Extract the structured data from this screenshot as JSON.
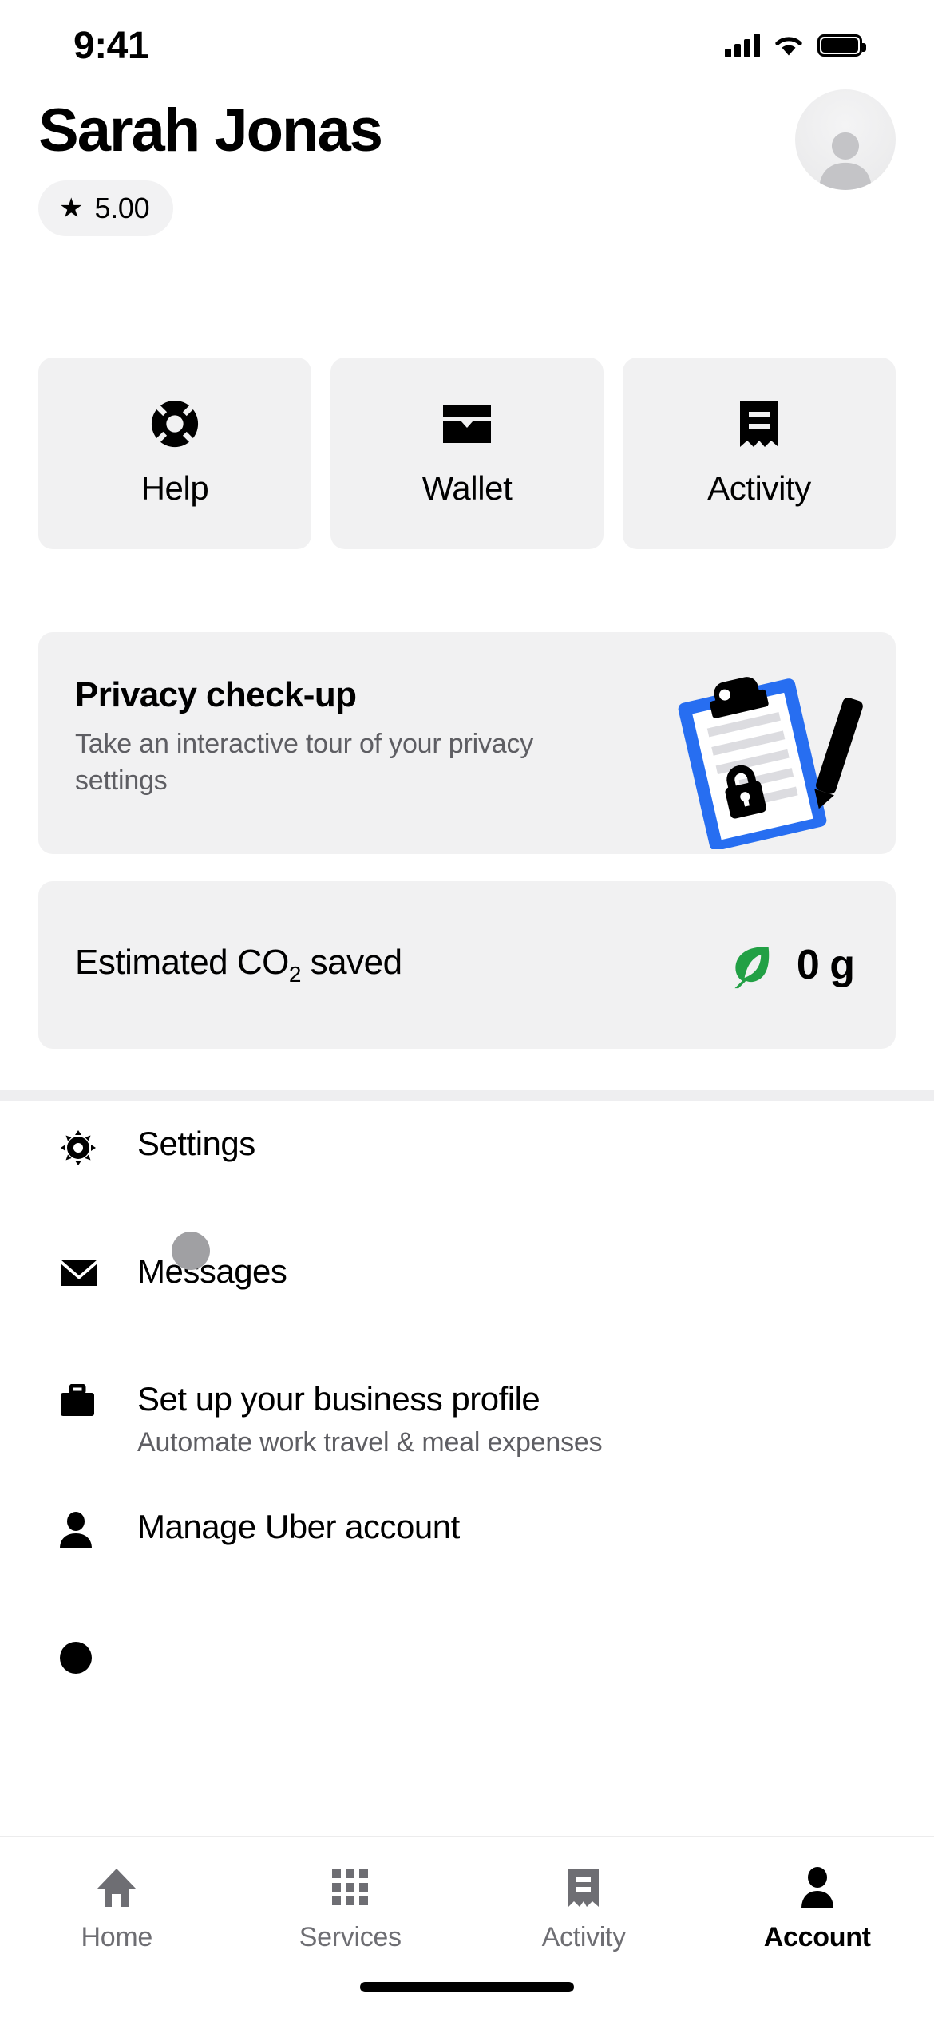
{
  "status_bar": {
    "time": "9:41",
    "cellular_icon": "signal-bars-icon",
    "wifi_icon": "wifi-icon",
    "battery_icon": "battery-full-icon"
  },
  "header": {
    "profile_name": "Sarah Jonas",
    "rating": {
      "star_icon": "star-icon",
      "value": "5.00"
    },
    "avatar_icon": "avatar-person-icon"
  },
  "quick_tiles": [
    {
      "label": "Help",
      "icon": "lifebuoy-icon"
    },
    {
      "label": "Wallet",
      "icon": "wallet-icon"
    },
    {
      "label": "Activity",
      "icon": "receipt-icon"
    }
  ],
  "privacy_card": {
    "title": "Privacy check-up",
    "subtitle": "Take an interactive tour of your privacy settings",
    "illustration_icon": "clipboard-lock-pen-illustration",
    "accent_color": "#276EF1"
  },
  "co2_card": {
    "label_prefix": "Estimated CO",
    "label_sub": "2",
    "label_suffix": " saved",
    "leaf_icon": "leaf-icon",
    "leaf_color": "#22A045",
    "value": "0 g"
  },
  "menu_items": [
    {
      "title": "Settings",
      "subtitle": "",
      "icon": "gear-icon"
    },
    {
      "title": "Messages",
      "subtitle": "",
      "icon": "envelope-icon"
    },
    {
      "title": "Set up your business profile",
      "subtitle": "Automate work travel & meal expenses",
      "icon": "briefcase-icon"
    },
    {
      "title": "Manage Uber account",
      "subtitle": "",
      "icon": "person-icon"
    }
  ],
  "tab_bar": [
    {
      "label": "Home",
      "icon": "home-icon",
      "active": false
    },
    {
      "label": "Services",
      "icon": "grid-icon",
      "active": false
    },
    {
      "label": "Activity",
      "icon": "receipt-icon",
      "active": false
    },
    {
      "label": "Account",
      "icon": "person-icon",
      "active": true
    }
  ]
}
